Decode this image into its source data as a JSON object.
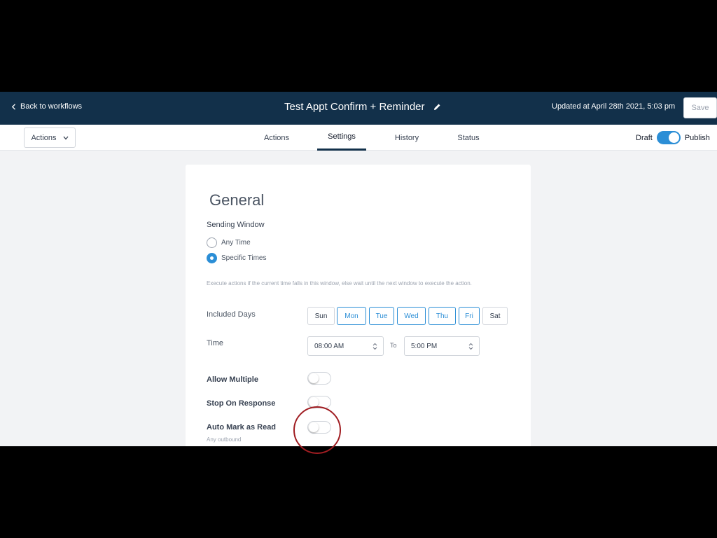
{
  "header": {
    "back_label": "Back to workflows",
    "title": "Test Appt Confirm + Reminder",
    "updated": "Updated at April 28th 2021, 5:03 pm",
    "save_label": "Save"
  },
  "subnav": {
    "actions_label": "Actions",
    "tabs": [
      {
        "label": "Actions",
        "active": false
      },
      {
        "label": "Settings",
        "active": true
      },
      {
        "label": "History",
        "active": false
      },
      {
        "label": "Status",
        "active": false
      }
    ],
    "draft_label": "Draft",
    "publish_label": "Publish",
    "published": true
  },
  "settings": {
    "heading": "General",
    "sending_window_label": "Sending Window",
    "options": [
      {
        "label": "Any Time",
        "checked": false
      },
      {
        "label": "Specific Times",
        "checked": true
      }
    ],
    "help_text": "Execute actions if the current time falls in this window, else wait until the next window to execute the action.",
    "included_days_label": "Included Days",
    "days": [
      {
        "label": "Sun",
        "selected": false
      },
      {
        "label": "Mon",
        "selected": true
      },
      {
        "label": "Tue",
        "selected": true
      },
      {
        "label": "Wed",
        "selected": true
      },
      {
        "label": "Thu",
        "selected": true
      },
      {
        "label": "Fri",
        "selected": true
      },
      {
        "label": "Sat",
        "selected": false
      }
    ],
    "time_label": "Time",
    "time_from": "08:00 AM",
    "time_to_label": "To",
    "time_to": "5:00 PM",
    "allow_multiple_label": "Allow Multiple",
    "allow_multiple": false,
    "stop_on_response_label": "Stop On Response",
    "stop_on_response": false,
    "auto_mark_label": "Auto Mark as Read",
    "auto_mark": false,
    "auto_mark_help": "Any outbound"
  },
  "colors": {
    "header_bg": "#12304a",
    "accent": "#2b8ed6",
    "click_indicator": "#a01d22"
  }
}
